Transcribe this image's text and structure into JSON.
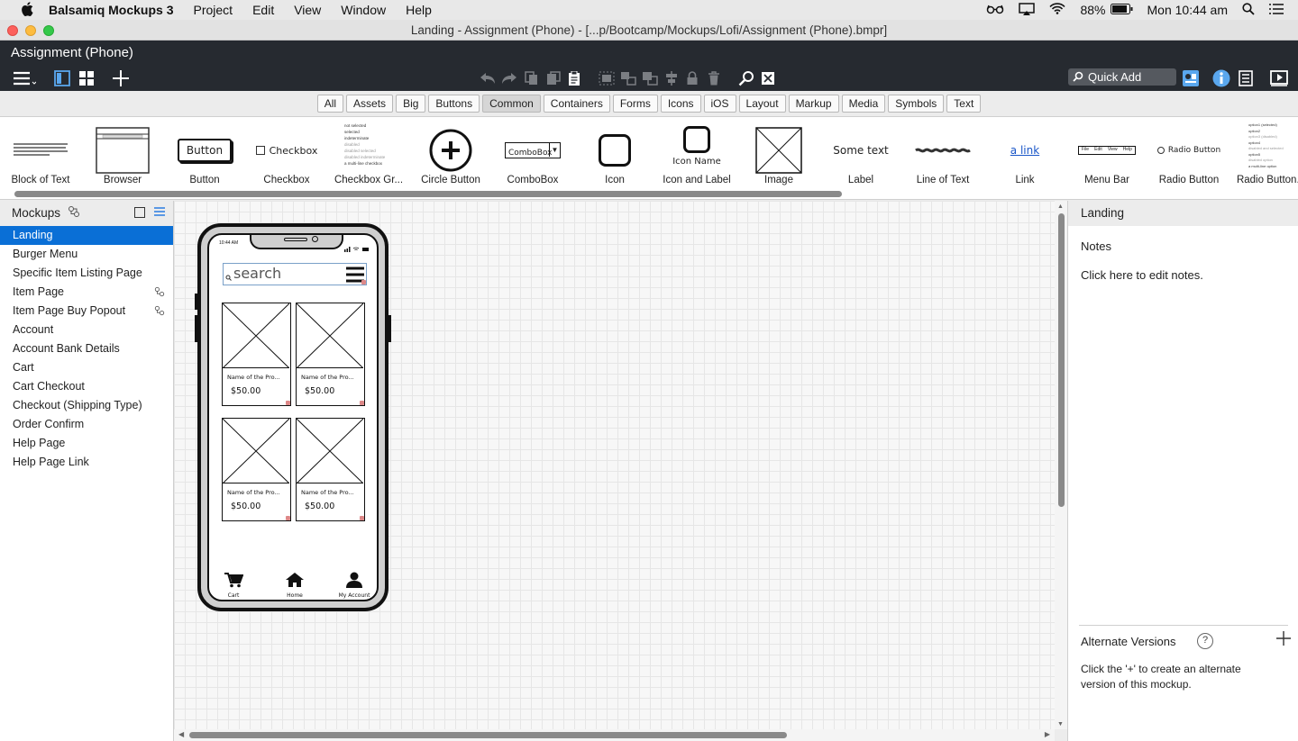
{
  "menubar": {
    "app_name": "Balsamiq Mockups 3",
    "items": [
      "Project",
      "Edit",
      "View",
      "Window",
      "Help"
    ],
    "battery": "88%",
    "clock": "Mon 10:44 am"
  },
  "titlebar": {
    "title": "Landing - Assignment (Phone) - [...p/Bootcamp/Mockups/Lofi/Assignment (Phone).bmpr]"
  },
  "header": {
    "project_title": "Assignment (Phone)",
    "quick_add_placeholder": "Quick Add"
  },
  "category_tabs": {
    "items": [
      "All",
      "Assets",
      "Big",
      "Buttons",
      "Common",
      "Containers",
      "Forms",
      "Icons",
      "iOS",
      "Layout",
      "Markup",
      "Media",
      "Symbols",
      "Text"
    ],
    "active": "Common"
  },
  "library": {
    "items": [
      {
        "label": "Block of Text"
      },
      {
        "label": "Browser"
      },
      {
        "label": "Button",
        "sample": "Button"
      },
      {
        "label": "Checkbox",
        "sample": "Checkbox"
      },
      {
        "label": "Checkbox Gr...",
        "sample_lines": [
          "not selected",
          "selected",
          "indeterminate",
          "disabled",
          "disabled selected",
          "disabled indeterminate",
          "a multi-line checkbox"
        ]
      },
      {
        "label": "Circle Button"
      },
      {
        "label": "ComboBox",
        "sample": "ComboBox"
      },
      {
        "label": "Icon"
      },
      {
        "label": "Icon and Label",
        "sample": "Icon Name"
      },
      {
        "label": "Image"
      },
      {
        "label": "Label",
        "sample": "Some text"
      },
      {
        "label": "Line of Text"
      },
      {
        "label": "Link",
        "sample": "a link"
      },
      {
        "label": "Menu Bar",
        "sample_items": [
          "File",
          "Edit",
          "View",
          "Help"
        ]
      },
      {
        "label": "Radio Button",
        "sample": "Radio Button"
      },
      {
        "label": "Radio Button...",
        "sample_lines": [
          "option1 (selected)",
          "option2",
          "option3 (disabled)",
          "option4",
          "disabled and selected",
          "option5",
          "disabled option",
          "a multi-line option"
        ]
      }
    ]
  },
  "sidebar": {
    "title": "Mockups",
    "items": [
      {
        "label": "Landing",
        "selected": true
      },
      {
        "label": "Burger Menu"
      },
      {
        "label": "Specific Item Listing Page"
      },
      {
        "label": "Item Page",
        "linked": true
      },
      {
        "label": "Item Page Buy Popout",
        "linked": true
      },
      {
        "label": "Account"
      },
      {
        "label": "Account Bank Details"
      },
      {
        "label": "Cart"
      },
      {
        "label": "Cart Checkout"
      },
      {
        "label": "Checkout (Shipping Type)"
      },
      {
        "label": "Order Confirm"
      },
      {
        "label": "Help Page"
      },
      {
        "label": "Help Page Link"
      }
    ]
  },
  "mockup": {
    "status_time": "10:44 AM",
    "search_placeholder": "search",
    "products": [
      {
        "name": "Name of the Pro...",
        "price": "$50.00"
      },
      {
        "name": "Name of the Pro...",
        "price": "$50.00"
      },
      {
        "name": "Name of the Pro...",
        "price": "$50.00"
      },
      {
        "name": "Name of the Pro...",
        "price": "$50.00"
      }
    ],
    "nav": [
      {
        "label": "Cart",
        "icon": "cart-icon"
      },
      {
        "label": "Home",
        "icon": "home-icon"
      },
      {
        "label": "My Account",
        "icon": "user-icon"
      }
    ]
  },
  "rightpanel": {
    "title": "Landing",
    "notes_heading": "Notes",
    "notes_body": "Click here to edit notes.",
    "alt_heading": "Alternate Versions",
    "alt_help": "?",
    "alt_body": "Click the '+' to create an alternate version of this mockup."
  },
  "colors": {
    "accent": "#0a6fd6",
    "header_bg": "#262a30",
    "canvas_bg": "#f7f7f7"
  }
}
